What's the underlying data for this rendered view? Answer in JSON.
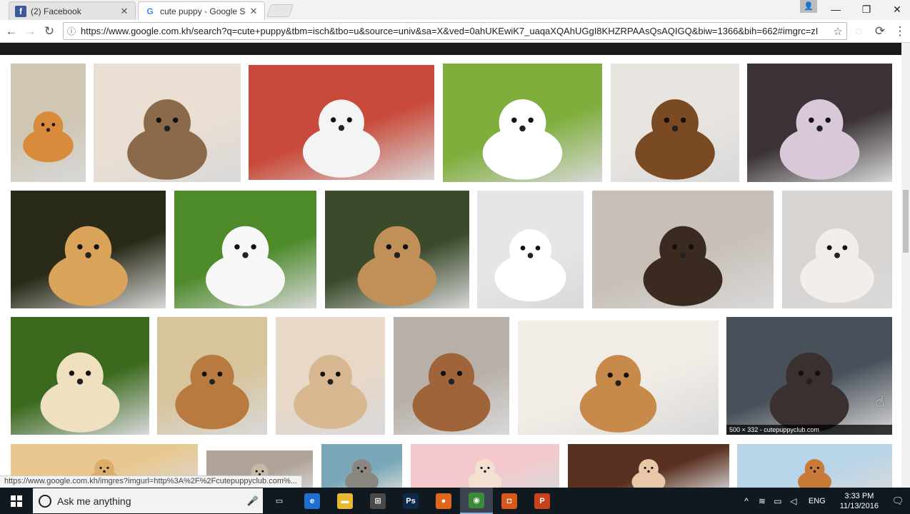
{
  "browser": {
    "tabs": [
      {
        "title": "(2) Facebook",
        "favicon": "facebook-icon",
        "active": false
      },
      {
        "title": "cute puppy - Google Sea",
        "favicon": "google-icon",
        "active": true
      }
    ],
    "tab_close_glyph": "✕",
    "window_controls": {
      "minimize": "—",
      "maximize": "❐",
      "close": "✕"
    },
    "user_glyph": "👤",
    "nav": {
      "back": "←",
      "forward": "→",
      "reload": "↻"
    },
    "info_glyph": "ⓘ",
    "url": "https://www.google.com.kh/search?q=cute+puppy&tbm=isch&tbo=u&source=univ&sa=X&ved=0ahUKEwiK7_uaqaXQAhUGgI8KHZRPAAsQsAQIGQ&biw=1366&bih=662#imgrc=zI",
    "star_glyph": "☆",
    "extension_glyphs": [
      "◌",
      "⟳",
      "⋮"
    ]
  },
  "results": {
    "images": [
      {
        "name": "pomeranian-orange",
        "bg": "#cfc6b4",
        "dog": "#d98a3a",
        "row": 1
      },
      {
        "name": "pomeranian-hand",
        "bg": "#eadfd2",
        "dog": "#8a6a4a",
        "row": 1
      },
      {
        "name": "teacup-white-puppy",
        "bg": "#c94a3a",
        "dog": "#f4f4f4",
        "row": 1
      },
      {
        "name": "white-pom-grass",
        "bg": "#7fae3c",
        "dog": "#ffffff",
        "row": 1
      },
      {
        "name": "beagle-puppy-lying",
        "bg": "#e8e4e0",
        "dog": "#7a4a22",
        "row": 1
      },
      {
        "name": "puppies-in-clothes",
        "bg": "#3a3236",
        "dog": "#d8c8d8",
        "row": 1
      },
      {
        "name": "three-golden-puppies",
        "bg": "#2a2a18",
        "dog": "#d9a45a",
        "row": 2
      },
      {
        "name": "white-puppy-duckling",
        "bg": "#4c8a2a",
        "dog": "#f7f7f7",
        "row": 2
      },
      {
        "name": "two-puppies-running",
        "bg": "#3a4a2a",
        "dog": "#c09058",
        "row": 2
      },
      {
        "name": "white-pom-fluffy",
        "bg": "#e6e6e8",
        "dog": "#ffffff",
        "row": 2
      },
      {
        "name": "beagle-walking",
        "bg": "#c8c0b8",
        "dog": "#3a2a20",
        "row": 2
      },
      {
        "name": "maltese-in-hand",
        "bg": "#d8d4d2",
        "dog": "#f2eeea",
        "row": 2
      },
      {
        "name": "lab-and-kitten",
        "bg": "#3b6a1e",
        "dog": "#efe0c0",
        "row": 3
      },
      {
        "name": "bulldog-puppy",
        "bg": "#d8c49c",
        "dog": "#b97a40",
        "row": 3
      },
      {
        "name": "fluffy-beige-puppy",
        "bg": "#e8d8c8",
        "dog": "#d8b890",
        "row": 3
      },
      {
        "name": "golden-puppy-bowtie",
        "bg": "#b8b0a8",
        "dog": "#a0643a",
        "row": 3
      },
      {
        "name": "corgi-sleeping",
        "bg": "#f2ece6",
        "dog": "#c88a4a",
        "row": 3
      },
      {
        "name": "husky-yawning",
        "bg": "#48505a",
        "dog": "#3a3030",
        "row": 3
      },
      {
        "name": "golden-puppy-partial",
        "bg": "#e8c890",
        "dog": "#dcae6a",
        "row": 4
      },
      {
        "name": "puppy-partial-2",
        "bg": "#b0a498",
        "dog": "#c8b8a8",
        "row": 4
      },
      {
        "name": "gray-puppy-partial",
        "bg": "#7aa8b8",
        "dog": "#8a8680",
        "row": 4
      },
      {
        "name": "pink-blanket-puppy",
        "bg": "#f4c8cc",
        "dog": "#f4e0d0",
        "row": 4
      },
      {
        "name": "puppies-basket-partial",
        "bg": "#5a3020",
        "dog": "#e8c8a8",
        "row": 4
      },
      {
        "name": "corgi-partial",
        "bg": "#b8d4e8",
        "dog": "#c87a38",
        "row": 4
      }
    ],
    "hover_caption": "500 × 332 - cutepuppyclub.com"
  },
  "status_link": "https://www.google.com.kh/imgres?imgurl=http%3A%2F%2Fcutepuppyclub.com%...",
  "taskbar": {
    "search_placeholder": "Ask me anything",
    "mic_glyph": "🎤",
    "apps": [
      {
        "name": "task-view",
        "label": "▭",
        "color": "#101820"
      },
      {
        "name": "edge",
        "label": "e",
        "color": "#1f6fd0"
      },
      {
        "name": "file-explorer",
        "label": "▬",
        "color": "#e8b830"
      },
      {
        "name": "store",
        "label": "⊞",
        "color": "#4a4a4a"
      },
      {
        "name": "photoshop",
        "label": "Ps",
        "color": "#0d2a4a"
      },
      {
        "name": "firefox",
        "label": "●",
        "color": "#e0661c"
      },
      {
        "name": "chrome",
        "label": "◉",
        "color": "#3a8a3a"
      },
      {
        "name": "app-orange",
        "label": "◘",
        "color": "#d8581c"
      },
      {
        "name": "powerpoint",
        "label": "P",
        "color": "#c8421c"
      }
    ],
    "tray": {
      "chevron": "^",
      "wifi": "≋",
      "battery": "▭",
      "volume": "◁",
      "lang": "ENG"
    },
    "time": "3:33 PM",
    "date": "11/13/2016",
    "notif_glyph": "🗨"
  }
}
